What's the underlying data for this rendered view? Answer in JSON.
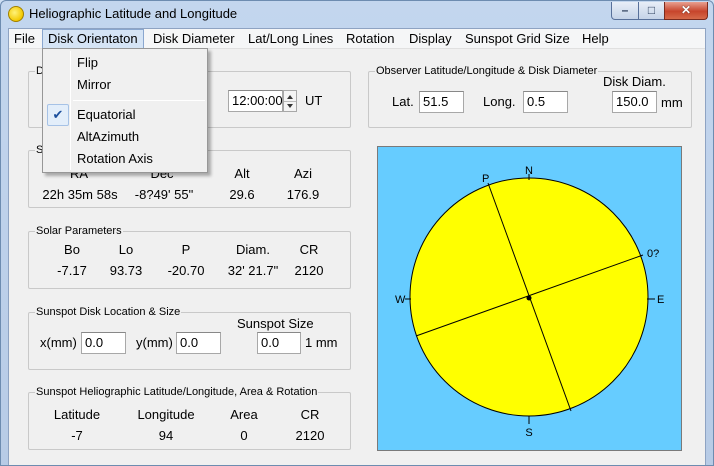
{
  "window": {
    "title": "Heliographic Latitude and Longitude"
  },
  "menu": {
    "items": [
      "File",
      "Disk Orientaton",
      "Disk Diameter",
      "Lat/Long Lines",
      "Rotation",
      "Display",
      "Sunspot Grid Size",
      "Help"
    ]
  },
  "orientation_menu": {
    "items": [
      "Flip",
      "Mirror",
      "Equatorial",
      "AltAzimuth",
      "Rotation Axis"
    ],
    "checked": "Equatorial"
  },
  "datetime": {
    "caption_initial": "D",
    "time": "12:00:00",
    "time_unit": "UT"
  },
  "sun_position": {
    "caption_initial": "S",
    "headers": [
      "RA",
      "Dec",
      "Alt",
      "Azi"
    ],
    "values": [
      "22h 35m 58s",
      "-8?49' 55\"",
      "29.6",
      "176.9"
    ]
  },
  "solar_parameters": {
    "caption": "Solar Parameters",
    "headers": [
      "Bo",
      "Lo",
      "P",
      "Diam.",
      "CR"
    ],
    "values": [
      "-7.17",
      "93.73",
      "-20.70",
      "32' 21.7\"",
      "2120"
    ]
  },
  "sunspot_location": {
    "caption": "Sunspot Disk Location & Size",
    "x_label": "x(mm)",
    "x_value": "0.0",
    "y_label": "y(mm)",
    "y_value": "0.0",
    "size_label": "Sunspot Size",
    "size_value": "0.0",
    "size_unit": "1 mm"
  },
  "sunspot_heliographic": {
    "caption": "Sunspot Heliographic Latitude/Longitude, Area & Rotation",
    "headers": [
      "Latitude",
      "Longitude",
      "Area",
      "CR"
    ],
    "values": [
      "-7",
      "94",
      "0",
      "2120"
    ]
  },
  "observer": {
    "caption": "Observer Latitude/Longitude & Disk Diameter",
    "lat_label": "Lat.",
    "lat_value": "51.5",
    "long_label": "Long.",
    "long_value": "0.5",
    "diam_label": "Disk Diam.",
    "diam_value": "150.0",
    "diam_unit": "mm"
  },
  "disk": {
    "labels": {
      "north": "N",
      "south": "S",
      "east": "E",
      "west": "W",
      "pole": "P",
      "meridian": "0?"
    },
    "colors": {
      "background": "#66ccff",
      "sun": "#ffff00",
      "outline": "#000000"
    }
  }
}
